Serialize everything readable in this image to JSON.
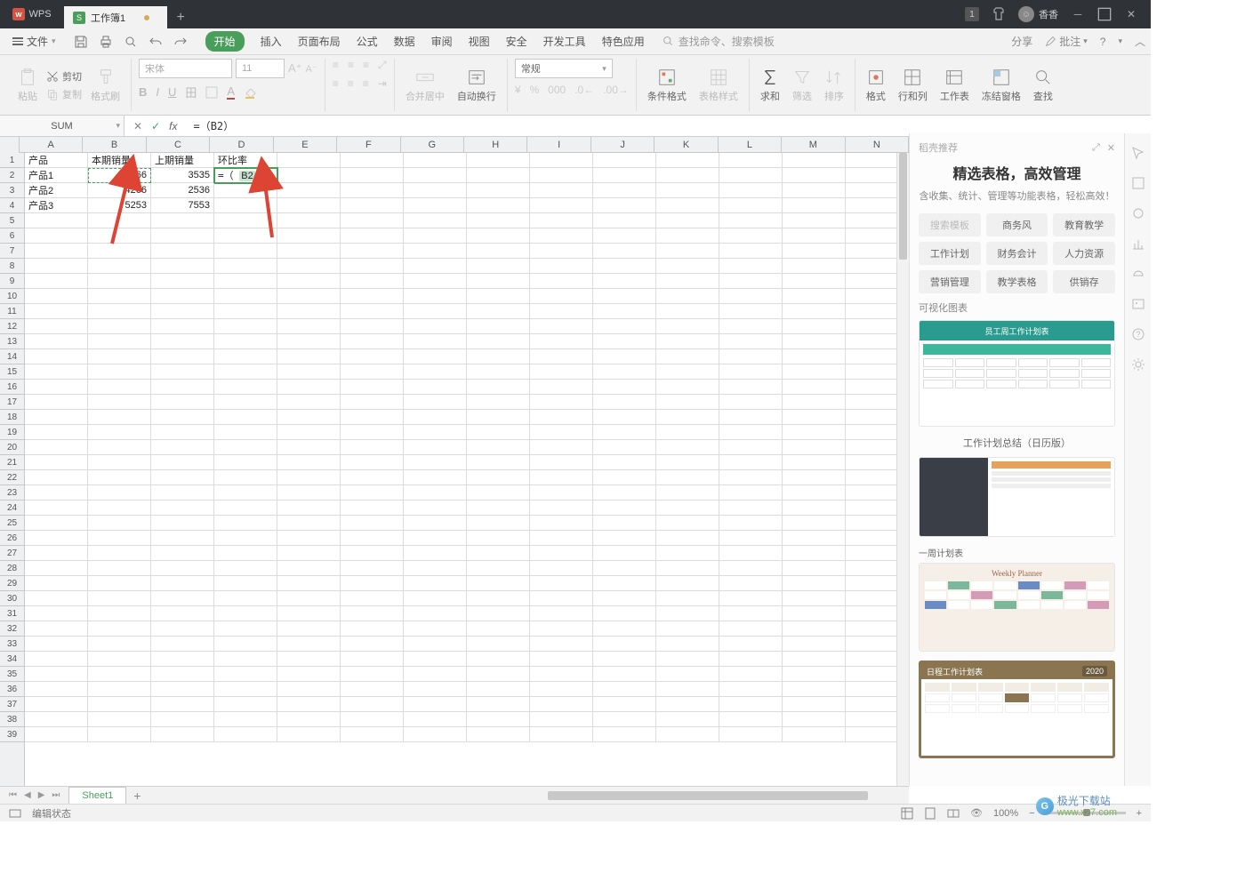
{
  "titlebar": {
    "app": "WPS",
    "doc_tab": "工作簿1",
    "user": "香香",
    "badge": "1"
  },
  "menubar": {
    "file": "文件",
    "tabs": [
      "开始",
      "插入",
      "页面布局",
      "公式",
      "数据",
      "审阅",
      "视图",
      "安全",
      "开发工具",
      "特色应用"
    ],
    "search_placeholder": "查找命令、搜索模板",
    "share": "分享",
    "annotate": "批注"
  },
  "ribbon": {
    "paste": "粘贴",
    "cut": "剪切",
    "copy": "复制",
    "format_painter": "格式刷",
    "font_name": "宋体",
    "font_size": "11",
    "merge": "合并居中",
    "wrap": "自动换行",
    "number_format": "常规",
    "cond_format": "条件格式",
    "table_style": "表格样式",
    "sum": "求和",
    "filter": "筛选",
    "sort": "排序",
    "format": "格式",
    "rowcol": "行和列",
    "worksheet": "工作表",
    "freeze": "冻结窗格",
    "find": "查找"
  },
  "formulabar": {
    "name": "SUM",
    "formula": "=（B2）"
  },
  "grid": {
    "columns": [
      "A",
      "B",
      "C",
      "D",
      "E",
      "F",
      "G",
      "H",
      "I",
      "J",
      "K",
      "L",
      "M",
      "N"
    ],
    "headers": {
      "A": "产品",
      "B": "本期销量",
      "C": "上期销量",
      "D": "环比率"
    },
    "rows": [
      {
        "A": "产品1",
        "B": "5266",
        "C": "3535",
        "D_formula": "=（ B2 ）"
      },
      {
        "A": "产品2",
        "B": "4266",
        "C": "2536"
      },
      {
        "A": "产品3",
        "B": "5253",
        "C": "7553"
      }
    ],
    "active_cell": "D2",
    "ref_cell": "B2",
    "row_count": 39
  },
  "sidepanel": {
    "header": "稻壳推荐",
    "title": "精选表格，高效管理",
    "subtitle": "含收集、统计、管理等功能表格，轻松高效！",
    "tabs1": [
      "搜索模板",
      "商务风",
      "教育教学"
    ],
    "tabs2": [
      "工作计划",
      "财务会计",
      "人力资源"
    ],
    "tabs3": [
      "营销管理",
      "教学表格",
      "供销存"
    ],
    "section": "可视化图表",
    "tpl1_caption": "员工周工作计划表",
    "tpl2_title": "工作计划总结（日历版）",
    "tpl3_caption": "一周计划表",
    "tpl3_header": "Weekly Planner",
    "tpl4_caption": "日程工作计划表"
  },
  "sheets": {
    "active": "Sheet1"
  },
  "statusbar": {
    "mode": "编辑状态",
    "zoom": "100%"
  },
  "watermark": {
    "site": "极光下载站",
    "url": "www.xz7.com"
  }
}
